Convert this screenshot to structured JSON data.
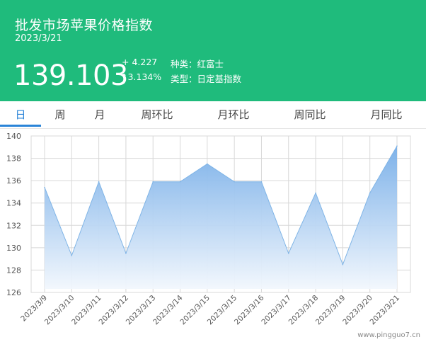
{
  "header": {
    "title": "批发市场苹果价格指数",
    "date": "2023/3/21",
    "price": "139.103",
    "change": "+ 4.227",
    "change_pct": "↑3.134%",
    "variety": "种类：红富士",
    "type": "类型：日定基指数"
  },
  "tabs": [
    "日",
    "周",
    "月",
    "周环比",
    "月环比",
    "周同比",
    "月同比"
  ],
  "watermark": "www.pingguo7.cn",
  "colors": {
    "header_bg": "#1fbb7c",
    "accent": "#2a84d8",
    "line": "#7fb4e6",
    "fill_top": "#77aee8",
    "fill_bottom": "#f2f7fd"
  },
  "chart_data": {
    "type": "area",
    "x": [
      "2023/3/9",
      "2023/3/10",
      "2023/3/11",
      "2023/3/12",
      "2023/3/13",
      "2023/3/14",
      "2023/3/15",
      "2023/3/15",
      "2023/3/16",
      "2023/3/17",
      "2023/3/18",
      "2023/3/19",
      "2023/3/20",
      "2023/3/21"
    ],
    "values": [
      135.4,
      129.3,
      135.9,
      129.5,
      135.9,
      135.9,
      137.5,
      135.9,
      135.9,
      129.5,
      134.9,
      128.5,
      134.9,
      139.1
    ],
    "ylim": [
      126,
      140
    ],
    "yticks": [
      "126",
      "128",
      "130",
      "132",
      "134",
      "136",
      "138",
      "140"
    ],
    "grid": true
  }
}
